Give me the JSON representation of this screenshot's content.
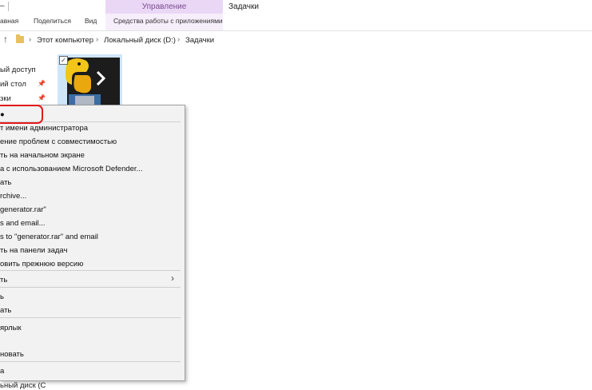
{
  "ribbon": {
    "title_fragment": "–",
    "manage_label": "Управление",
    "window_title": "Задачки",
    "tabs": [
      "авная",
      "Поделиться",
      "Вид",
      "Средства работы с приложениями"
    ]
  },
  "address": {
    "crumbs": [
      "Этот компьютер",
      "Локальный диск (D:)",
      "Задачки"
    ]
  },
  "nav": {
    "items": [
      "ый доступ",
      "ий стол",
      "зки"
    ]
  },
  "menu": {
    "items": [
      "●",
      "т имени администратора",
      "ение проблем с совместимостью",
      "ть на начальном экране",
      "а с использованием Microsoft Defender...",
      "ать",
      "rchive...",
      "generator.rar\"",
      "s and email...",
      "s to \"generator.rar\" and email",
      "ть на панели задач",
      "овить прежнюю версию",
      "ть",
      "ь",
      "ать",
      "ярлык",
      "новать",
      "а"
    ]
  },
  "bottom": {
    "label": "ьный диск (C"
  },
  "colors": {
    "manage_tab": "#ead7f6",
    "highlight": "#e21b1b"
  }
}
